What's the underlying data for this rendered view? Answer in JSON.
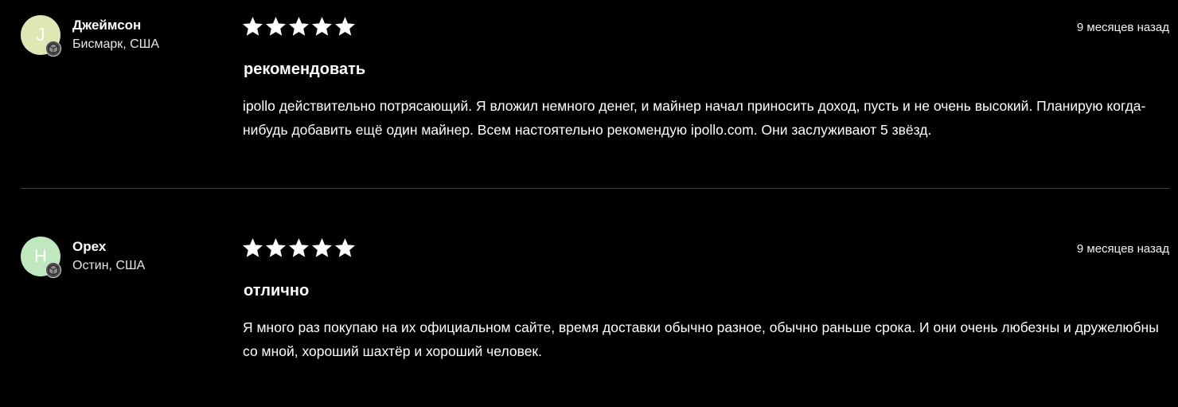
{
  "colors": {
    "background": "#000000",
    "text": "#ffffff",
    "divider": "#3d3d3d",
    "star": "#ffffff",
    "badge": "#4b4b4b"
  },
  "reviews": [
    {
      "avatar_letter": "J",
      "avatar_color": "#dfe8b4",
      "name": "Джеймсон",
      "location": "Бисмарк, США",
      "rating": 5,
      "date": "9 месяцев назад",
      "title": "рекомендовать",
      "body": "ipollo действительно потрясающий. Я вложил немного денег, и майнер начал приносить доход, пусть и не очень высокий. Планирую когда-нибудь добавить ещё один майнер. Всем настоятельно рекомендую ipollo.com. Они заслуживают 5 звёзд."
    },
    {
      "avatar_letter": "H",
      "avatar_color": "#bfe8bf",
      "name": "Орех",
      "location": "Остин, США",
      "rating": 5,
      "date": "9 месяцев назад",
      "title": "отлично",
      "body": "Я много раз покупаю на их официальном сайте, время доставки обычно разное, обычно раньше срока. И они очень любезны и дружелюбны со мной, хороший шахтёр и хороший человек."
    }
  ]
}
